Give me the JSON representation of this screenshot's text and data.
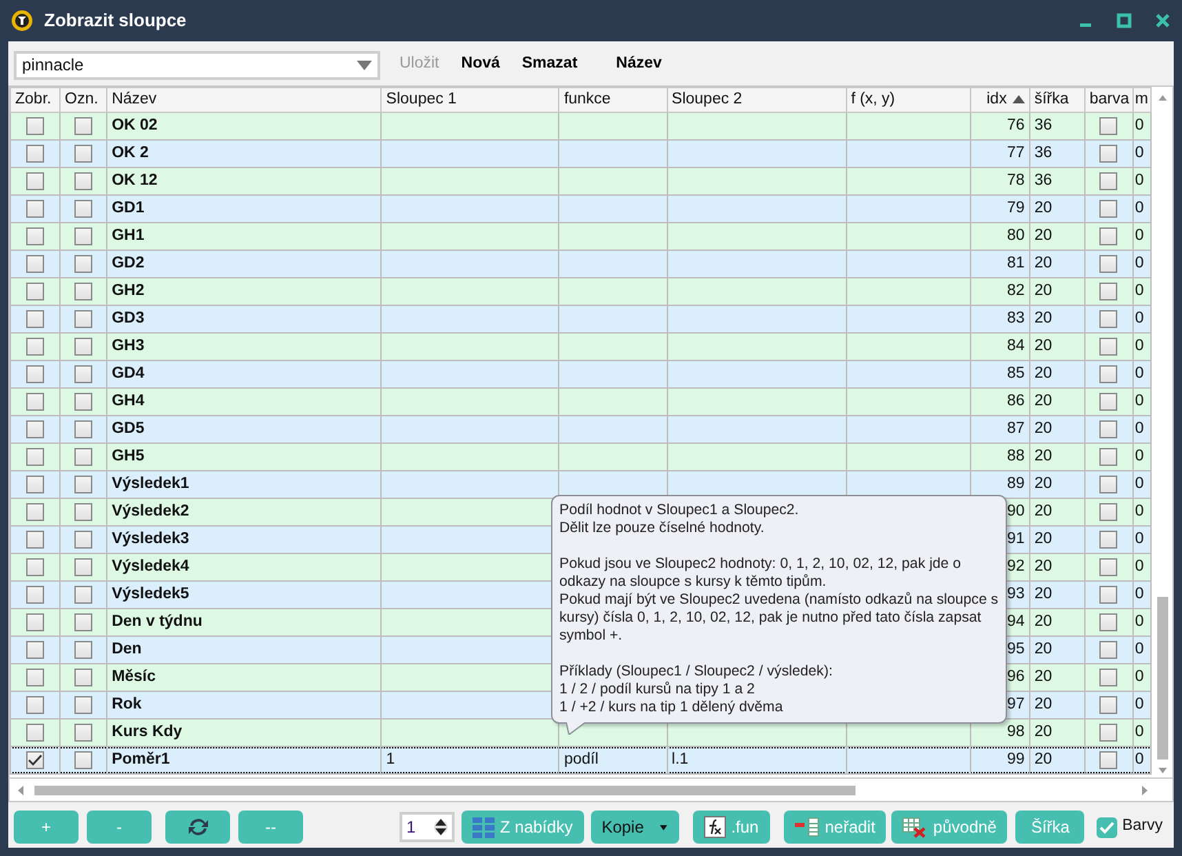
{
  "window": {
    "title": "Zobrazit sloupce"
  },
  "toolbar": {
    "preset": "pinnacle",
    "buttons": [
      {
        "label": "Uložit",
        "disabled": true
      },
      {
        "label": "Nová",
        "disabled": false
      },
      {
        "label": "Smazat",
        "disabled": false
      },
      {
        "label": "Název",
        "disabled": false
      }
    ]
  },
  "table": {
    "columns": [
      {
        "label": "Zobr.",
        "kind": "check"
      },
      {
        "label": "Ozn.",
        "kind": "check"
      },
      {
        "label": "Název",
        "kind": "bold"
      },
      {
        "label": "Sloupec 1",
        "kind": "text"
      },
      {
        "label": "funkce",
        "kind": "text"
      },
      {
        "label": "Sloupec 2",
        "kind": "text"
      },
      {
        "label": "f (x, y)",
        "kind": "text"
      },
      {
        "label": "idx",
        "kind": "num",
        "sorted": true
      },
      {
        "label": "šířka",
        "kind": "text"
      },
      {
        "label": "barva",
        "kind": "check"
      },
      {
        "label": "m",
        "kind": "text"
      }
    ],
    "rows": [
      {
        "cells": [
          false,
          false,
          "OK 02",
          "",
          "",
          "",
          "",
          "76",
          "36",
          false,
          "0"
        ],
        "color": "#ddf9e4",
        "selected": false
      },
      {
        "cells": [
          false,
          false,
          "OK 2",
          "",
          "",
          "",
          "",
          "77",
          "36",
          false,
          "0"
        ],
        "color": "#dbeefc",
        "selected": false
      },
      {
        "cells": [
          false,
          false,
          "OK 12",
          "",
          "",
          "",
          "",
          "78",
          "36",
          false,
          "0"
        ],
        "color": "#ddf9e4",
        "selected": false
      },
      {
        "cells": [
          false,
          false,
          "GD1",
          "",
          "",
          "",
          "",
          "79",
          "20",
          false,
          "0"
        ],
        "color": "#dbeefc",
        "selected": false
      },
      {
        "cells": [
          false,
          false,
          "GH1",
          "",
          "",
          "",
          "",
          "80",
          "20",
          false,
          "0"
        ],
        "color": "#ddf9e4",
        "selected": false
      },
      {
        "cells": [
          false,
          false,
          "GD2",
          "",
          "",
          "",
          "",
          "81",
          "20",
          false,
          "0"
        ],
        "color": "#dbeefc",
        "selected": false
      },
      {
        "cells": [
          false,
          false,
          "GH2",
          "",
          "",
          "",
          "",
          "82",
          "20",
          false,
          "0"
        ],
        "color": "#ddf9e4",
        "selected": false
      },
      {
        "cells": [
          false,
          false,
          "GD3",
          "",
          "",
          "",
          "",
          "83",
          "20",
          false,
          "0"
        ],
        "color": "#dbeefc",
        "selected": false
      },
      {
        "cells": [
          false,
          false,
          "GH3",
          "",
          "",
          "",
          "",
          "84",
          "20",
          false,
          "0"
        ],
        "color": "#ddf9e4",
        "selected": false
      },
      {
        "cells": [
          false,
          false,
          "GD4",
          "",
          "",
          "",
          "",
          "85",
          "20",
          false,
          "0"
        ],
        "color": "#dbeefc",
        "selected": false
      },
      {
        "cells": [
          false,
          false,
          "GH4",
          "",
          "",
          "",
          "",
          "86",
          "20",
          false,
          "0"
        ],
        "color": "#ddf9e4",
        "selected": false
      },
      {
        "cells": [
          false,
          false,
          "GD5",
          "",
          "",
          "",
          "",
          "87",
          "20",
          false,
          "0"
        ],
        "color": "#dbeefc",
        "selected": false
      },
      {
        "cells": [
          false,
          false,
          "GH5",
          "",
          "",
          "",
          "",
          "88",
          "20",
          false,
          "0"
        ],
        "color": "#ddf9e4",
        "selected": false
      },
      {
        "cells": [
          false,
          false,
          "Výsledek1",
          "",
          "",
          "",
          "",
          "89",
          "20",
          false,
          "0"
        ],
        "color": "#dbeefc",
        "selected": false
      },
      {
        "cells": [
          false,
          false,
          "Výsledek2",
          "",
          "",
          "",
          "",
          "90",
          "20",
          false,
          "0"
        ],
        "color": "#ddf9e4",
        "selected": false
      },
      {
        "cells": [
          false,
          false,
          "Výsledek3",
          "",
          "",
          "",
          "",
          "91",
          "20",
          false,
          "0"
        ],
        "color": "#dbeefc",
        "selected": false
      },
      {
        "cells": [
          false,
          false,
          "Výsledek4",
          "",
          "",
          "",
          "",
          "92",
          "20",
          false,
          "0"
        ],
        "color": "#ddf9e4",
        "selected": false
      },
      {
        "cells": [
          false,
          false,
          "Výsledek5",
          "",
          "",
          "",
          "",
          "93",
          "20",
          false,
          "0"
        ],
        "color": "#dbeefc",
        "selected": false
      },
      {
        "cells": [
          false,
          false,
          "Den v týdnu",
          "",
          "",
          "",
          "",
          "94",
          "20",
          false,
          "0"
        ],
        "color": "#ddf9e4",
        "selected": false
      },
      {
        "cells": [
          false,
          false,
          "Den",
          "",
          "",
          "",
          "",
          "95",
          "20",
          false,
          "0"
        ],
        "color": "#dbeefc",
        "selected": false
      },
      {
        "cells": [
          false,
          false,
          "Měsíc",
          "",
          "",
          "",
          "",
          "96",
          "20",
          false,
          "0"
        ],
        "color": "#ddf9e4",
        "selected": false
      },
      {
        "cells": [
          false,
          false,
          "Rok",
          "",
          "",
          "",
          "",
          "97",
          "20",
          false,
          "0"
        ],
        "color": "#dbeefc",
        "selected": false
      },
      {
        "cells": [
          false,
          false,
          "Kurs Kdy",
          "",
          "",
          "",
          "",
          "98",
          "20",
          false,
          "0"
        ],
        "color": "#ddf9e4",
        "selected": false
      },
      {
        "cells": [
          true,
          false,
          "Poměr1",
          "1",
          "podíl",
          "l.1",
          "",
          "99",
          "20",
          false,
          "0"
        ],
        "color": "#dbeefc",
        "selected": true
      }
    ]
  },
  "tooltip": {
    "paragraphs": [
      [
        "Podíl hodnot v Sloupec1 a Sloupec2.",
        "Dělit lze pouze číselné hodnoty."
      ],
      [
        "Pokud jsou ve Sloupec2 hodnoty: 0, 1, 2, 10, 02, 12, pak jde o",
        "odkazy na sloupce s kursy k těmto tipům.",
        "Pokud mají být ve Sloupec2 uvedena (namísto odkazů na sloupce s",
        "kursy) čísla 0, 1, 2, 10, 02, 12, pak je nutno před tato čísla zapsat",
        "symbol +."
      ],
      [
        "Příklady (Sloupec1 / Sloupec2 / výsledek):",
        "1 / 2 / podíl kursů na tipy 1 a 2",
        "1 / +2 / kurs na tip 1 dělený dvěma"
      ]
    ]
  },
  "bottom": {
    "buttons": [
      {
        "label": "+",
        "kind": "text"
      },
      {
        "label": "-",
        "kind": "text"
      },
      {
        "kind": "refresh"
      },
      {
        "label": "--",
        "kind": "text"
      }
    ],
    "spinner": "1",
    "actions": [
      {
        "label": "Z nabídky",
        "kind": "grid"
      },
      {
        "label": "Kopie",
        "kind": "dropdown"
      },
      {
        "label": ".fun",
        "kind": "fx"
      },
      {
        "label": "neřadit",
        "kind": "nosort"
      },
      {
        "label": "původně",
        "kind": "reset"
      },
      {
        "label": "Šířka",
        "kind": "text"
      }
    ],
    "colors_checkbox": {
      "label": "Barvy",
      "checked": true
    }
  }
}
